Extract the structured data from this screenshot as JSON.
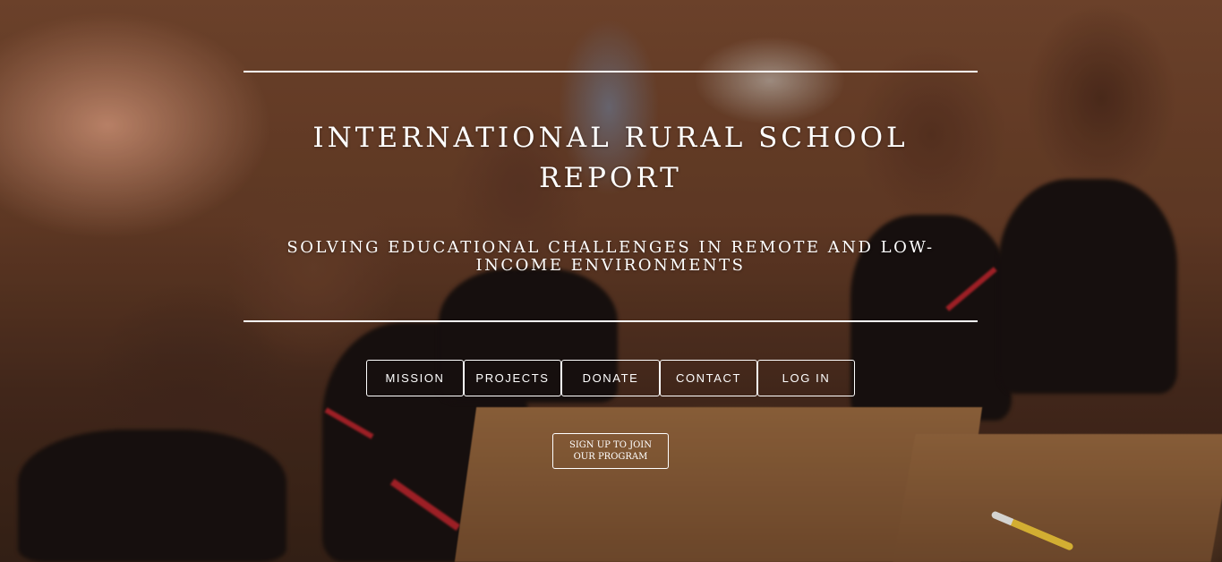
{
  "header": {
    "title": "INTERNATIONAL RURAL SCHOOL REPORT",
    "subtitle": "SOLVING EDUCATIONAL CHALLENGES IN REMOTE AND LOW-INCOME ENVIRONMENTS"
  },
  "nav": {
    "items": [
      {
        "label": "MISSION"
      },
      {
        "label": "PROJECTS"
      },
      {
        "label": "DONATE"
      },
      {
        "label": "CONTACT"
      },
      {
        "label": "LOG IN"
      }
    ]
  },
  "cta": {
    "label": "SIGN UP TO JOIN OUR PROGRAM"
  },
  "colors": {
    "text": "#ffffff",
    "rule": "#ffffff",
    "button_border": "#ffffff"
  }
}
